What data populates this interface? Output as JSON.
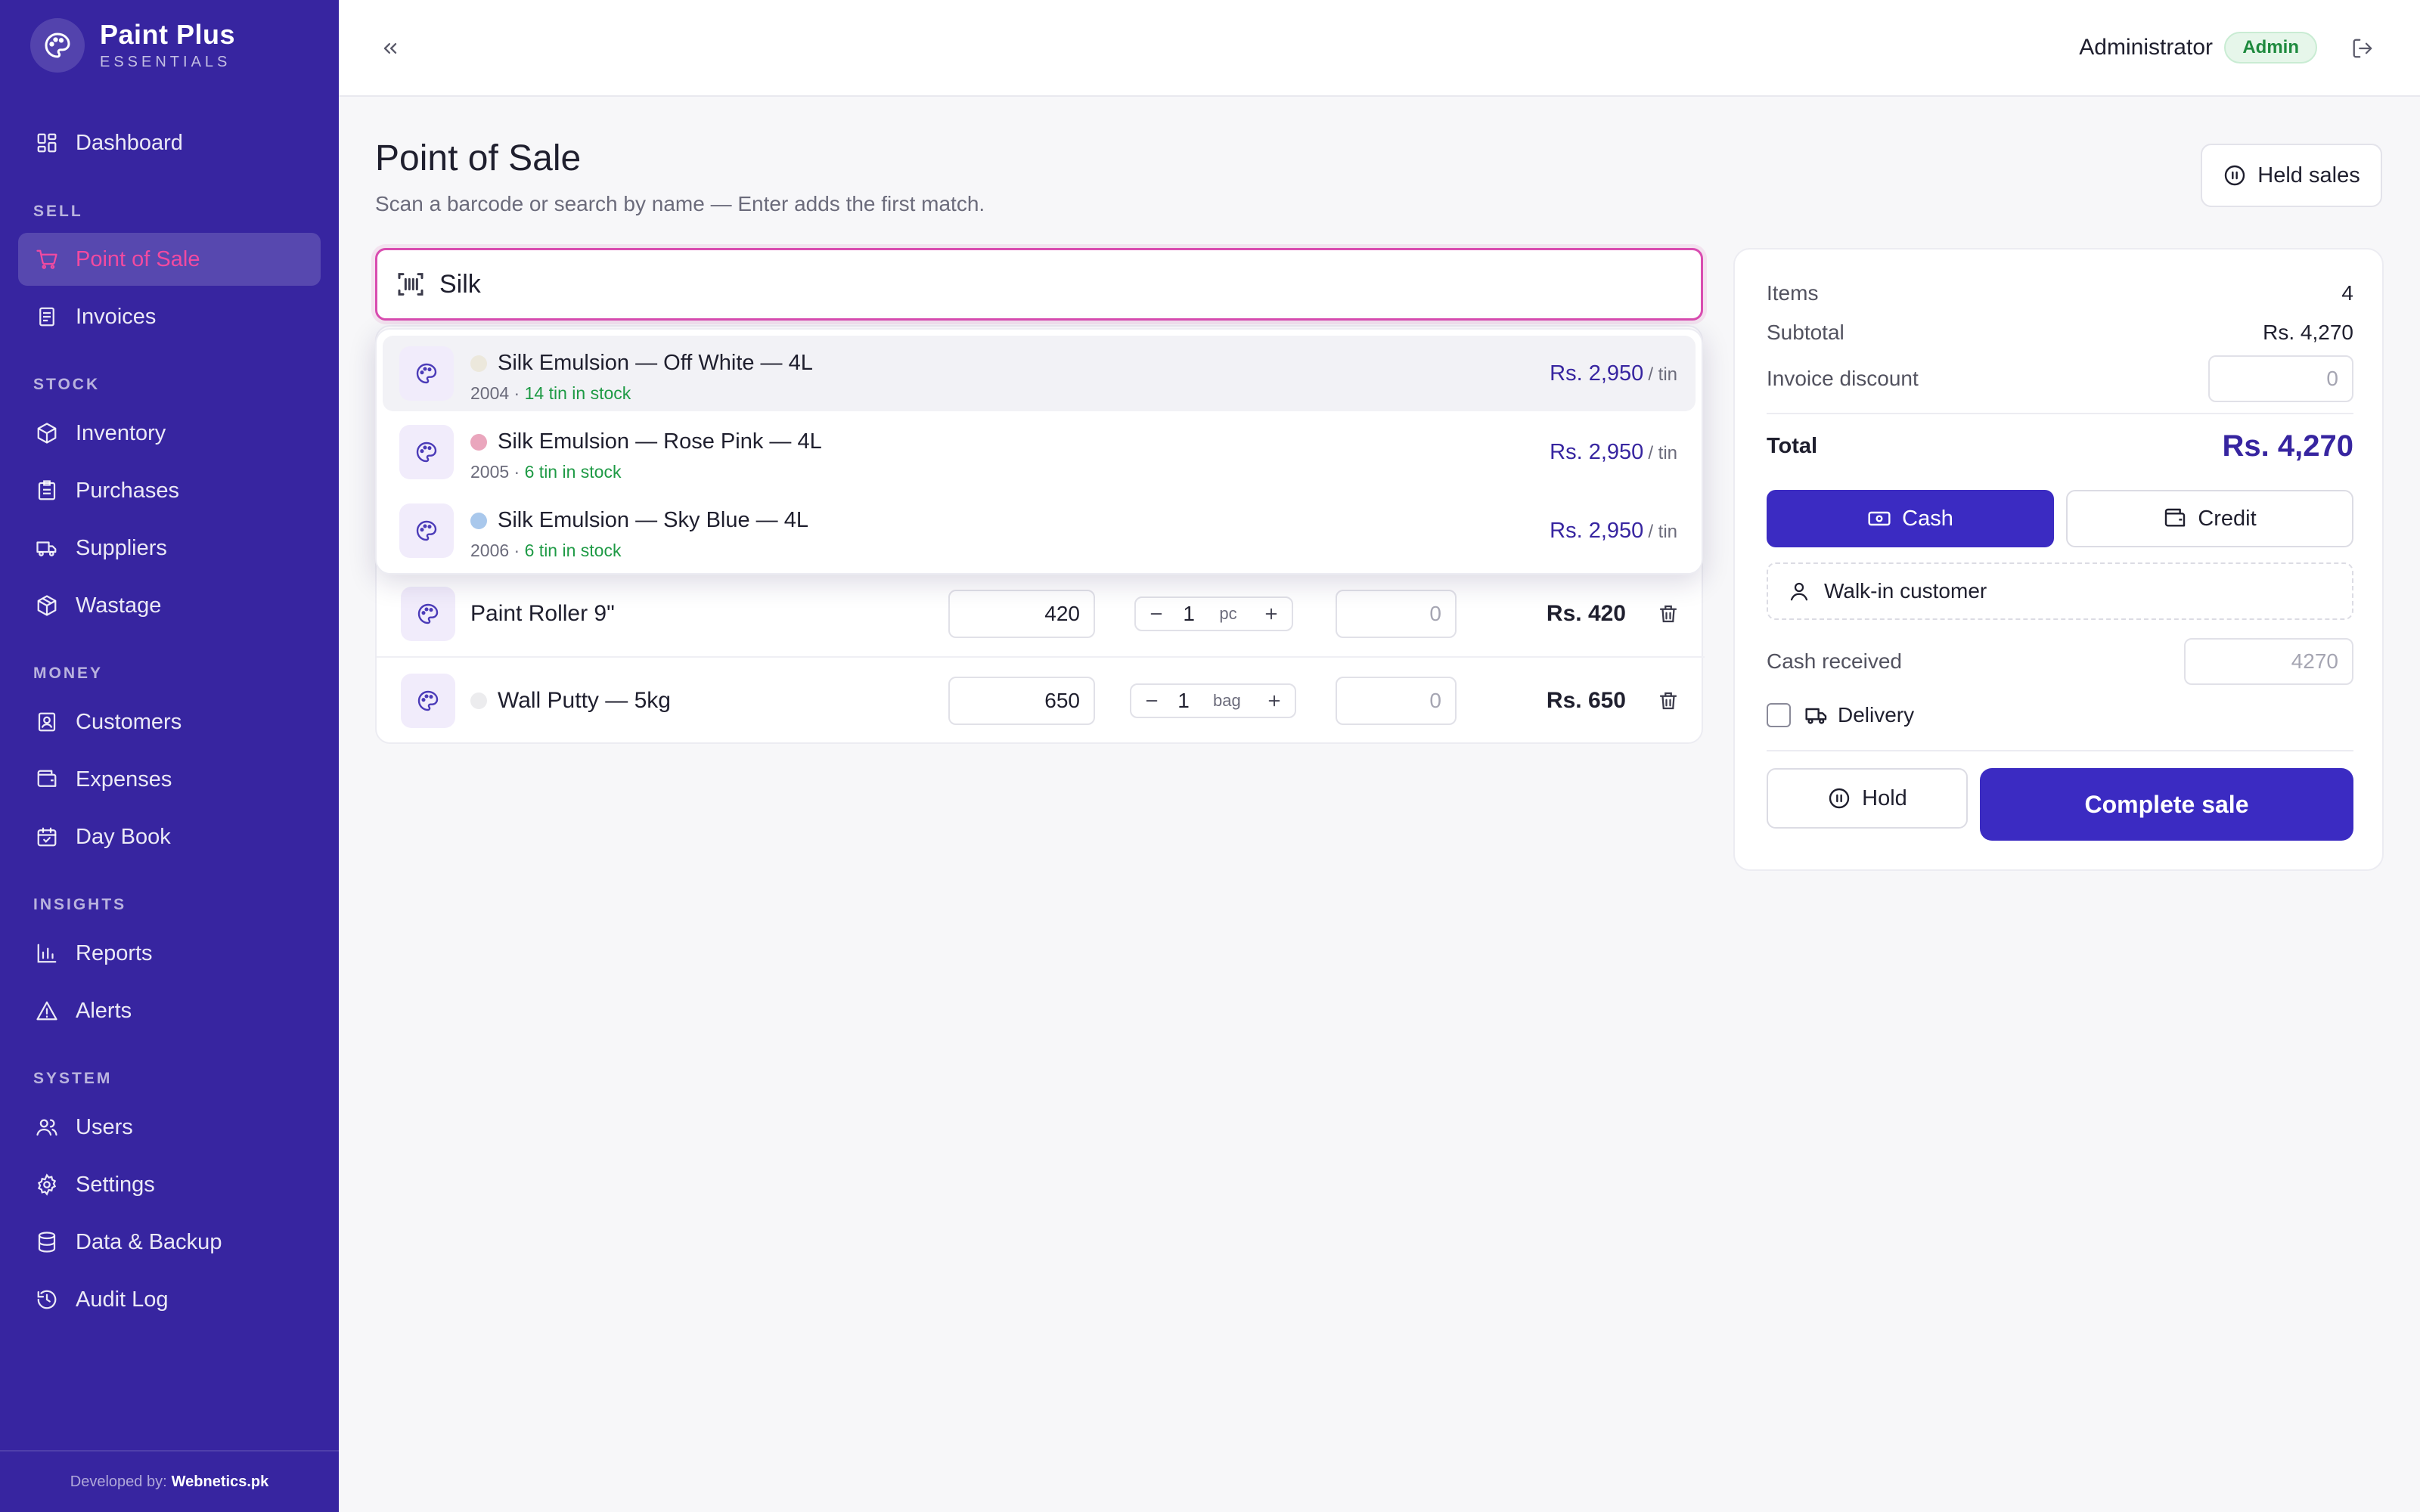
{
  "brand": {
    "name": "Paint Plus",
    "subtitle": "ESSENTIALS"
  },
  "sidebar": {
    "dashboard": "Dashboard",
    "sections": {
      "sell": "SELL",
      "stock": "STOCK",
      "money": "MONEY",
      "insights": "INSIGHTS",
      "system": "SYSTEM"
    },
    "items": [
      {
        "label": "Point of Sale",
        "icon": "cart-icon",
        "active": true
      },
      {
        "label": "Invoices",
        "icon": "invoice-icon"
      },
      {
        "label": "Inventory",
        "icon": "box-icon"
      },
      {
        "label": "Purchases",
        "icon": "clipboard-icon"
      },
      {
        "label": "Suppliers",
        "icon": "truck-icon"
      },
      {
        "label": "Wastage",
        "icon": "package-icon"
      },
      {
        "label": "Customers",
        "icon": "contact-icon"
      },
      {
        "label": "Expenses",
        "icon": "wallet-icon"
      },
      {
        "label": "Day Book",
        "icon": "calendar-icon"
      },
      {
        "label": "Reports",
        "icon": "bar-chart-icon"
      },
      {
        "label": "Alerts",
        "icon": "warning-icon"
      },
      {
        "label": "Users",
        "icon": "users-icon"
      },
      {
        "label": "Settings",
        "icon": "gear-icon"
      },
      {
        "label": "Data & Backup",
        "icon": "database-icon"
      },
      {
        "label": "Audit Log",
        "icon": "history-icon"
      }
    ],
    "footer_prefix": "Developed by:",
    "footer_company": "Webnetics.pk"
  },
  "topbar": {
    "user": "Administrator",
    "role": "Admin"
  },
  "page": {
    "title": "Point of Sale",
    "subtitle": "Scan a barcode or search by name — Enter adds the first match.",
    "held_sales": "Held sales"
  },
  "search": {
    "value": "Silk"
  },
  "dropdown": [
    {
      "name": "Silk Emulsion — Off White — 4L",
      "code": "2004",
      "stock": "14 tin in stock",
      "price": "Rs. 2,950",
      "unit": "/ tin",
      "swatch": "#ece8dc"
    },
    {
      "name": "Silk Emulsion — Rose Pink — 4L",
      "code": "2005",
      "stock": "6 tin in stock",
      "price": "Rs. 2,950",
      "unit": "/ tin",
      "swatch": "#eaa6bd"
    },
    {
      "name": "Silk Emulsion — Sky Blue — 4L",
      "code": "2006",
      "stock": "6 tin in stock",
      "price": "Rs. 2,950",
      "unit": "/ tin",
      "swatch": "#a9c8ec"
    }
  ],
  "cart": [
    {
      "name": "Paint Roller 9\"",
      "price": "420",
      "qty": "1",
      "unit": "pc",
      "discount": "0",
      "total": "Rs. 420"
    },
    {
      "name": "Wall Putty — 5kg",
      "price": "650",
      "qty": "1",
      "unit": "bag",
      "discount": "0",
      "total": "Rs. 650",
      "swatch": "#ececee"
    }
  ],
  "summary": {
    "items_label": "Items",
    "items_value": "4",
    "subtotal_label": "Subtotal",
    "subtotal_value": "Rs. 4,270",
    "discount_label": "Invoice discount",
    "discount_placeholder": "0",
    "total_label": "Total",
    "total_value": "Rs. 4,270",
    "cash_label": "Cash",
    "credit_label": "Credit",
    "customer": "Walk-in customer",
    "cash_received_label": "Cash received",
    "cash_received_placeholder": "4270",
    "delivery_label": "Delivery",
    "hold_label": "Hold",
    "complete_label": "Complete sale"
  },
  "colors": {
    "sidebar": "#3725a0",
    "primary": "#3b2bc2",
    "accent": "#d94cb0",
    "success": "#1e9a45"
  }
}
